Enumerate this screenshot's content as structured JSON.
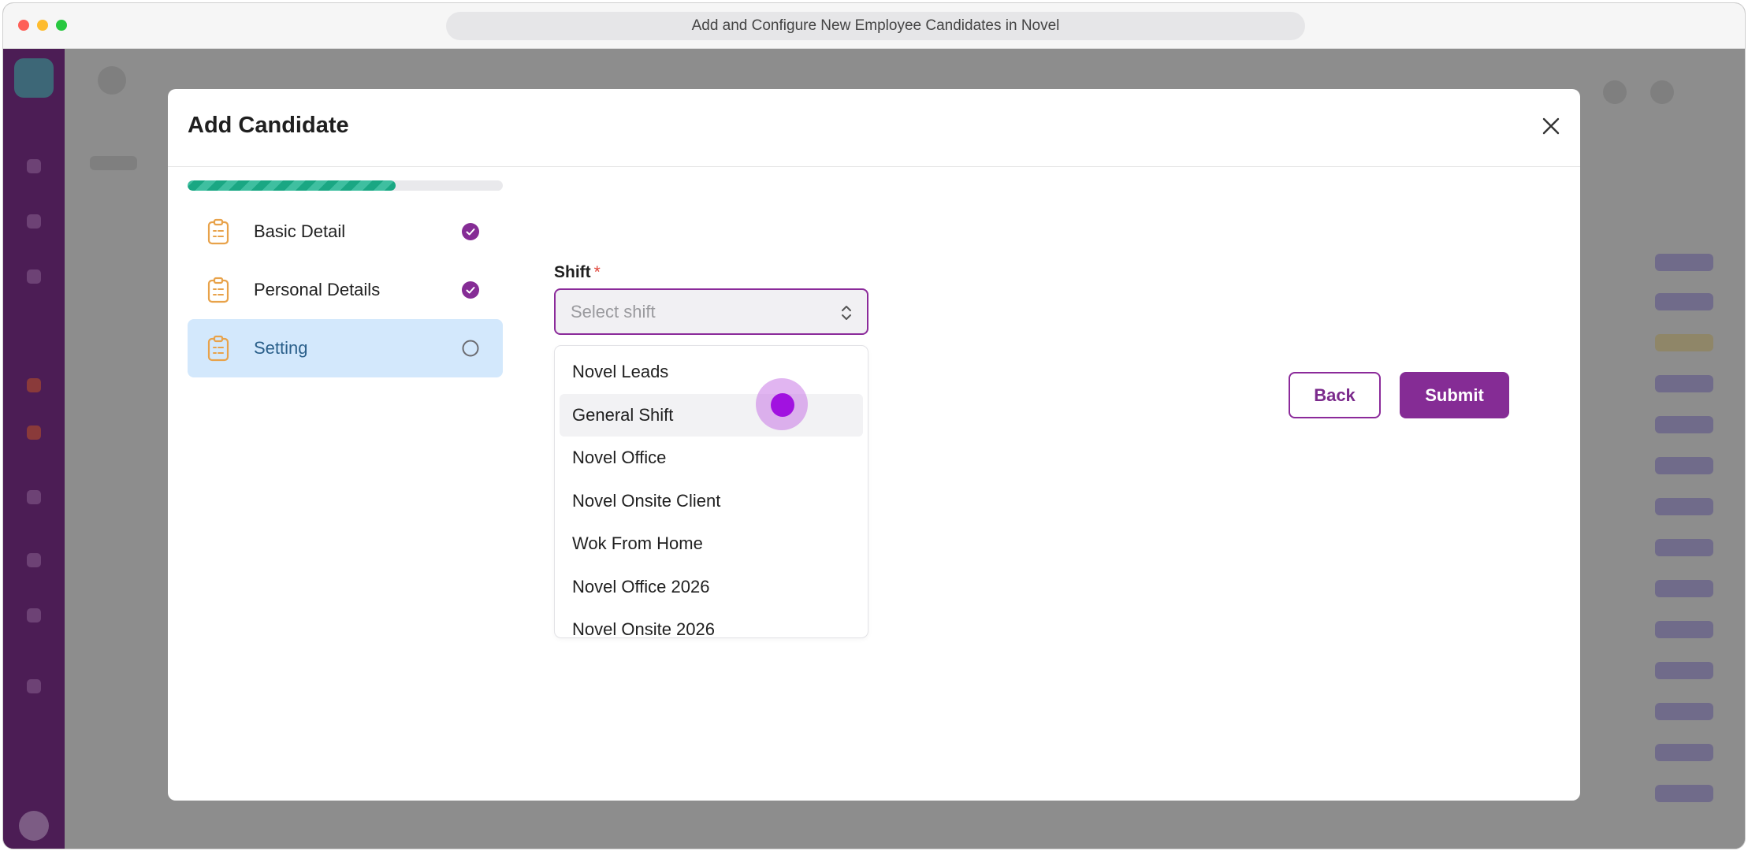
{
  "window": {
    "title": "Add and Configure New Employee Candidates in Novel"
  },
  "modal": {
    "title": "Add Candidate",
    "progress_fraction": 0.66,
    "steps": [
      {
        "label": "Basic Detail",
        "status": "completed"
      },
      {
        "label": "Personal Details",
        "status": "completed"
      },
      {
        "label": "Setting",
        "status": "current"
      }
    ],
    "shift_field": {
      "label": "Shift",
      "required_marker": "*",
      "placeholder": "Select shift",
      "options": [
        "Novel Leads",
        "General Shift",
        "Novel Office",
        "Novel Onsite Client",
        "Wok From Home",
        "Novel Office 2026",
        "Novel Onsite 2026"
      ],
      "hovered_option": "General Shift"
    },
    "buttons": {
      "back_label": "Back",
      "submit_label": "Submit"
    }
  },
  "colors": {
    "brand_purple": "#852c95",
    "progress_green": "#1aa783",
    "step_icon_orange": "#e8a24a",
    "active_step_bg": "#d3e8fc",
    "required_red": "#e0453a"
  },
  "icons": {
    "close": "close-icon",
    "step": "clipboard-icon",
    "completed": "check-circle-icon",
    "pending": "empty-circle-icon",
    "select": "chevron-up-down-icon"
  }
}
